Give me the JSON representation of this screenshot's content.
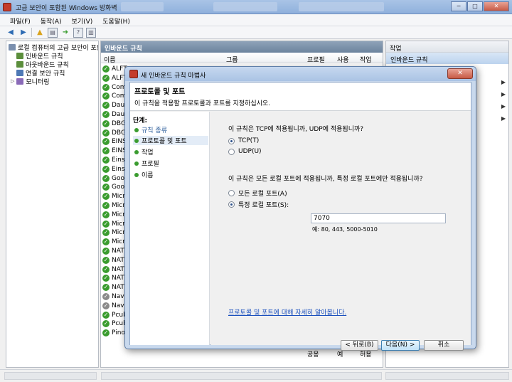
{
  "window": {
    "title": "고급 보안이 포함된 Windows 방화벽",
    "min": "─",
    "max": "□",
    "close": "✕"
  },
  "menu": [
    "파일(F)",
    "동작(A)",
    "보기(V)",
    "도움말(H)"
  ],
  "tree": {
    "items": [
      {
        "label": "로컬 컴퓨터의 고급 보안이 포함된",
        "level": 0
      },
      {
        "label": "인바운드 규칙",
        "level": 1
      },
      {
        "label": "아웃바운드 규칙",
        "level": 1
      },
      {
        "label": "연결 보안 규칙",
        "level": 1
      },
      {
        "label": "모니터링",
        "level": 1
      }
    ]
  },
  "center": {
    "header": "인바운드 규칙",
    "columns": {
      "name": "이름",
      "group": "그룹",
      "profile": "프로필",
      "enabled": "사용",
      "action": "작업"
    },
    "rows": [
      "ALFT",
      "ALFT",
      "Com",
      "Com",
      "Daum",
      "Daum",
      "DBGC",
      "DBGC",
      "EINS",
      "EINS",
      "Eins",
      "Eins V",
      "Goog",
      "Goog",
      "Micro",
      "Micro",
      "Micro",
      "Micro",
      "Micro",
      "Micro",
      "NATE",
      "NATE",
      "NATE",
      "NATE",
      "NATE",
      "Nave",
      "Nave",
      "Pcub",
      "Pcub",
      "Pino"
    ],
    "last_row": {
      "profile": "공용",
      "enabled": "예",
      "action": "허용"
    }
  },
  "actions": {
    "header": "작업",
    "selected": "인바운드 규칙"
  },
  "wizard": {
    "title": "새 인바운드 규칙 마법사",
    "close": "✕",
    "heading": "프로토콜 및 포트",
    "subheading": "이 규칙을 적용할 프로토콜과 포트를 지정하십시오.",
    "steps_title": "단계:",
    "steps": [
      "규칙 종류",
      "프로토콜 및 포트",
      "작업",
      "프로필",
      "이름"
    ],
    "question1": "이 규칙은 TCP에 적용됩니까, UDP에 적용됩니까?",
    "tcp": "TCP(T)",
    "udp": "UDP(U)",
    "question2": "이 규칙은 모든 로컬 포트에 적용됩니까, 특정 로컬 포트에만 적용됩니까?",
    "all_ports": "모든 로컬 포트(A)",
    "specific_ports": "특정 로컬 포트(S):",
    "port_value": "7070",
    "example": "예: 80, 443, 5000-5010",
    "help_link": "프로토콜 및 포트에 대해 자세히 알아봅니다.",
    "back": "< 뒤로(B)",
    "next": "다음(N) >",
    "cancel": "취소"
  }
}
